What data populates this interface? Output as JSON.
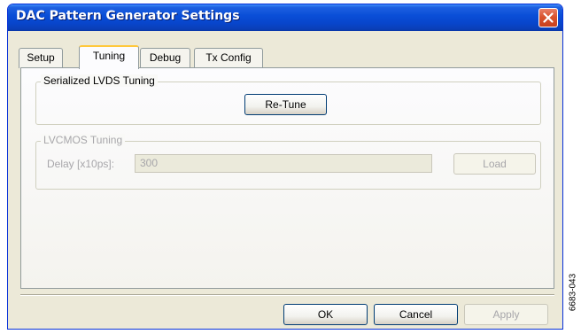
{
  "window": {
    "title": "DAC Pattern Generator Settings"
  },
  "tabs": [
    {
      "label": "Setup",
      "active": false
    },
    {
      "label": "Tuning",
      "active": true
    },
    {
      "label": "Debug",
      "active": false
    },
    {
      "label": "Tx Config",
      "active": false
    }
  ],
  "lvds_group": {
    "title": "Serialized LVDS Tuning",
    "retune_label": "Re-Tune"
  },
  "lvcmos_group": {
    "title": "LVCMOS Tuning",
    "enabled": false,
    "delay_label": "Delay [x10ps]:",
    "delay_value": "300",
    "load_label": "Load"
  },
  "footer": {
    "ok_label": "OK",
    "cancel_label": "Cancel",
    "apply_label": "Apply",
    "apply_enabled": false
  },
  "figure_code": "6683-043",
  "colors": {
    "titlebar": "#0a4fd8",
    "window_bg": "#ece9d8",
    "close_button": "#d9542f",
    "active_tab_highlight": "#ffc83c",
    "disabled_text": "#a7a6aa"
  }
}
